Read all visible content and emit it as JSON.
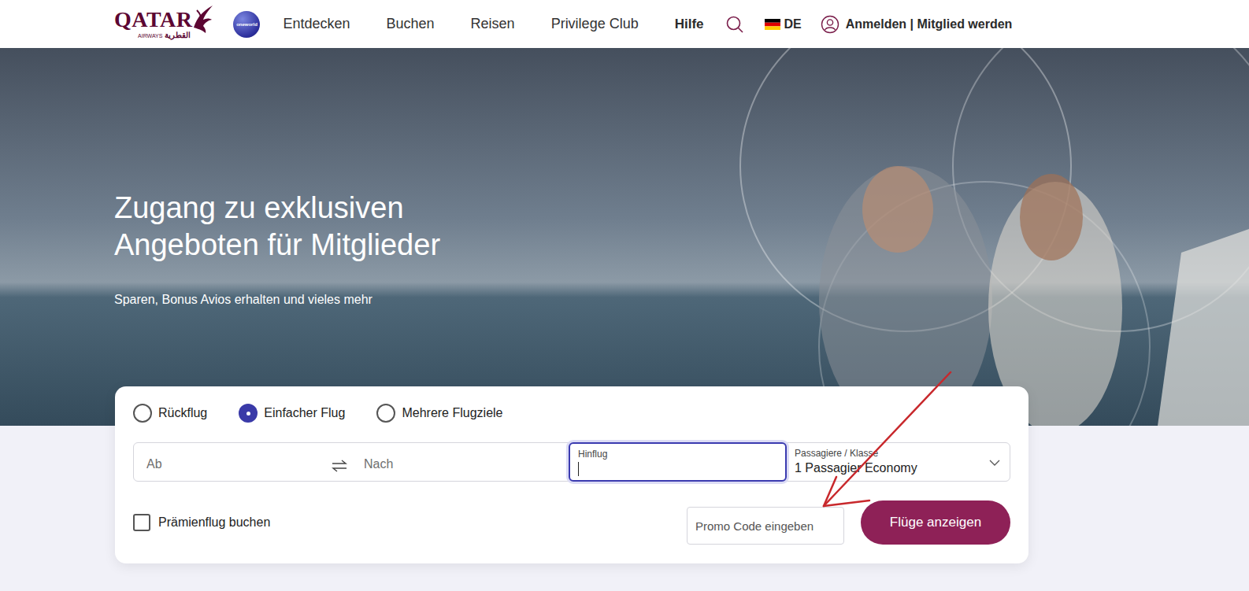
{
  "header": {
    "logo": "QATAR",
    "logo_sub": "AIRWAYS",
    "logo_arabic": "القطرية",
    "alliance": "oneworld",
    "nav": [
      {
        "label": "Entdecken",
        "bold": false
      },
      {
        "label": "Buchen",
        "bold": false
      },
      {
        "label": "Reisen",
        "bold": false
      },
      {
        "label": "Privilege Club",
        "bold": false
      },
      {
        "label": "Hilfe",
        "bold": true
      }
    ],
    "language": "DE",
    "account": "Anmelden | Mitglied werden"
  },
  "hero": {
    "title_lines": [
      "Zugang zu exklusiven",
      "Angeboten für Mitglieder"
    ],
    "subtitle": "Sparen, Bonus Avios erhalten und vieles mehr"
  },
  "booking": {
    "trip_types": [
      {
        "label": "Rückflug",
        "selected": false
      },
      {
        "label": "Einfacher Flug",
        "selected": true
      },
      {
        "label": "Mehrere Flugziele",
        "selected": false
      }
    ],
    "from": {
      "placeholder": "Ab"
    },
    "to": {
      "placeholder": "Nach"
    },
    "departure": {
      "label": "Hinflug",
      "value": "",
      "focused": true
    },
    "passengers": {
      "label": "Passagiere / Klasse",
      "value": "1 Passagier Economy"
    },
    "award": {
      "label": "Prämienflug buchen",
      "checked": false
    },
    "promo": {
      "placeholder": "Promo Code eingeben"
    },
    "submit": "Flüge anzeigen"
  }
}
